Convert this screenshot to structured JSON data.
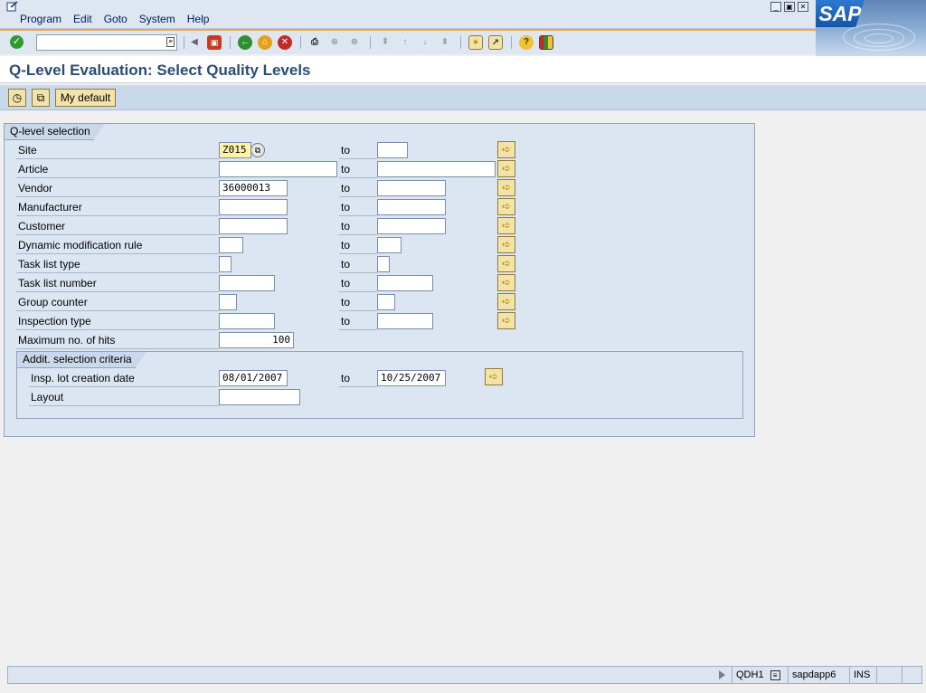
{
  "menu": {
    "items": [
      "Program",
      "Edit",
      "Goto",
      "System",
      "Help"
    ]
  },
  "brand": {
    "logo_text": "SAP",
    "accent": "#f1a64a",
    "title_color": "#2a4d78"
  },
  "toolbar": {
    "command_value": "",
    "enter_icon": "check-icon"
  },
  "page": {
    "title": "Q-Level Evaluation: Select Quality Levels"
  },
  "app_toolbar": {
    "my_default_label": "My default"
  },
  "selection": {
    "group_title": "Q-level selection",
    "to_label": "to",
    "rows": [
      {
        "label": "Site",
        "from": "Z015",
        "to": ""
      },
      {
        "label": "Article",
        "from": "",
        "to": ""
      },
      {
        "label": "Vendor",
        "from": "36000013",
        "to": ""
      },
      {
        "label": "Manufacturer",
        "from": "",
        "to": ""
      },
      {
        "label": "Customer",
        "from": "",
        "to": ""
      },
      {
        "label": "Dynamic modification rule",
        "from": "",
        "to": ""
      },
      {
        "label": "Task list type",
        "from": "",
        "to": ""
      },
      {
        "label": "Task list number",
        "from": "",
        "to": ""
      },
      {
        "label": "Group counter",
        "from": "",
        "to": ""
      },
      {
        "label": "Inspection type",
        "from": "",
        "to": ""
      }
    ],
    "max_hits_label": "Maximum no. of hits",
    "max_hits_value": "100",
    "addit": {
      "title": "Addit. selection criteria",
      "date_label": "Insp. lot creation date",
      "date_from": "08/01/2007",
      "date_to": "10/25/2007",
      "layout_label": "Layout",
      "layout_value": ""
    }
  },
  "status": {
    "system": "QDH1",
    "server": "sapdapp6",
    "mode": "INS"
  }
}
